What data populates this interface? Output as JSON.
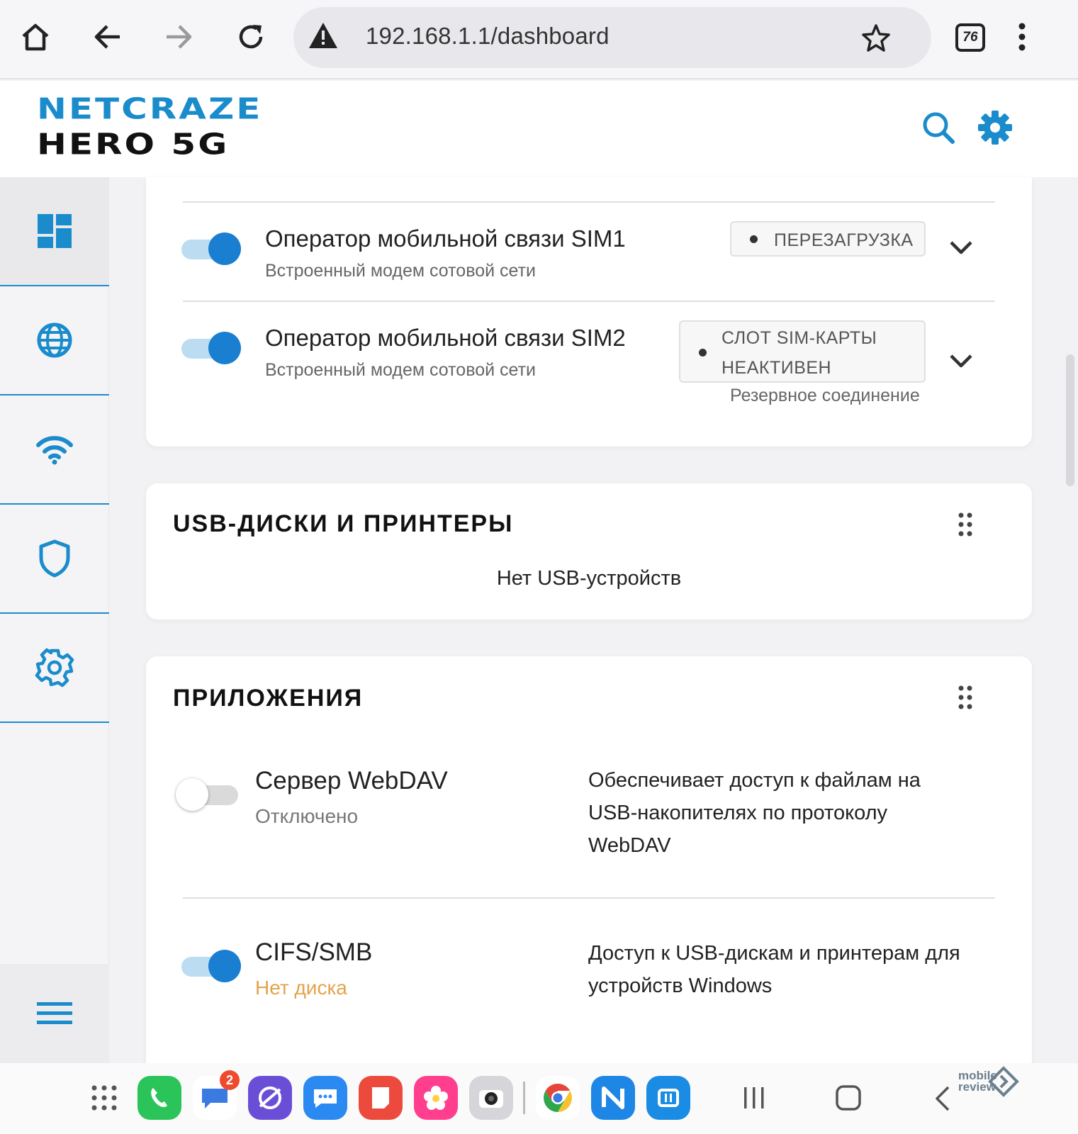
{
  "browser": {
    "url": "192.168.1.1/dashboard",
    "tab_count": "76"
  },
  "header": {
    "logo_line1": "NETCRAZE",
    "logo_line2": "HERO 5G"
  },
  "colors": {
    "accent": "#1a8ccc",
    "toggle_on": "#1a7fd1",
    "warning_text": "#e4a24a"
  },
  "sidebar": {
    "items": [
      {
        "icon": "dashboard-icon",
        "active": true
      },
      {
        "icon": "globe-icon"
      },
      {
        "icon": "wifi-icon"
      },
      {
        "icon": "shield-icon"
      },
      {
        "icon": "gear-icon"
      }
    ],
    "menu_icon": "hamburger-menu-icon"
  },
  "internet": {
    "rows": [
      {
        "title": "Оператор мобильной связи SIM1",
        "subtitle": "Встроенный модем сотовой сети",
        "status": "ПЕРЕЗАГРУЗКА",
        "enabled": true
      },
      {
        "title": "Оператор мобильной связи SIM2",
        "subtitle": "Встроенный модем сотовой сети",
        "status_line1": "СЛОТ SIM-КАРТЫ",
        "status_line2": "НЕАКТИВЕН",
        "note": "Резервное соединение",
        "enabled": true
      }
    ]
  },
  "usb": {
    "title": "USB-ДИСКИ И ПРИНТЕРЫ",
    "empty": "Нет USB-устройств"
  },
  "apps": {
    "title": "ПРИЛОЖЕНИЯ",
    "items": [
      {
        "name": "Сервер WebDAV",
        "status": "Отключено",
        "enabled": false,
        "desc_line1": "Обеспечивает доступ к файлам на",
        "desc_line2": "USB-накопителях по протоколу",
        "desc_line3": "WebDAV"
      },
      {
        "name": "CIFS/SMB",
        "status": "Нет диска",
        "enabled": true,
        "desc_line1": "Доступ к USB-дискам и принтерам для",
        "desc_line2": "устройств Windows"
      }
    ]
  },
  "taskbar": {
    "messages_badge": "2",
    "watermark_line1": "mobile",
    "watermark_line2": "review"
  }
}
